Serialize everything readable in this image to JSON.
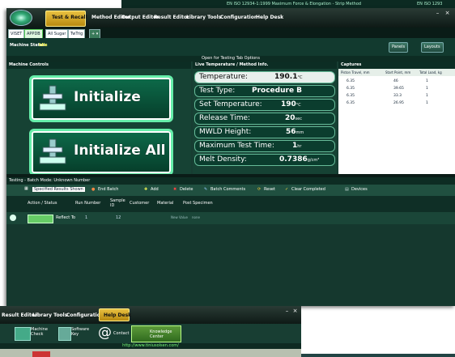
{
  "top_strip": {
    "text1": "EN ISO 12934-1:1999 Maximum Force & Elongation - Strip Method",
    "text2": "EN ISO 1293"
  },
  "menu": {
    "items": [
      "Test & Recall",
      "Method Editor",
      "Output Editor",
      "Result Editor",
      "Library Tools",
      "Configuration",
      "Help Desk"
    ]
  },
  "tabs": [
    "VISET",
    "APPDB",
    "All Sugar",
    "TwTrig"
  ],
  "status": {
    "label": "Machine Status:",
    "value": "Idle",
    "panels": "Panels",
    "layouts": "Layouts"
  },
  "open_testing": "Open for Testing Tab Options",
  "machine_controls": {
    "title": "Machine Controls",
    "initialize": "Initialize",
    "initialize_all": "Initialize All"
  },
  "live_temp": {
    "title": "Live Temperature / Method Info.",
    "rows": [
      {
        "label": "Temperature:",
        "value": "190.1",
        "unit": "°C"
      },
      {
        "label": "Test Type:",
        "value": "Procedure B",
        "unit": ""
      },
      {
        "label": "Set Temperature:",
        "value": "190",
        "unit": "°C"
      },
      {
        "label": "Release Time:",
        "value": "20",
        "unit": "sec"
      },
      {
        "label": "MWLD Height:",
        "value": "56",
        "unit": "mm"
      },
      {
        "label": "Maximum Test Time:",
        "value": "1",
        "unit": "hr"
      },
      {
        "label": "Melt Density:",
        "value": "0.7386",
        "unit": "g/cm³"
      }
    ]
  },
  "captures": {
    "title": "Captures",
    "headers": [
      "Piston Travel, mm",
      "Start Point, mm",
      "Total Load, kg"
    ],
    "rows": [
      [
        "6.35",
        "46",
        "1"
      ],
      [
        "6.35",
        "39.65",
        "1"
      ],
      [
        "6.35",
        "33.3",
        "1"
      ],
      [
        "6.35",
        "26.95",
        "1"
      ]
    ]
  },
  "testing_bar": "Testing - Batch Mode: Unknown Number",
  "toolbar": {
    "specified_results": "Specified Results Shown",
    "end_batch": "End Batch",
    "add": "Add",
    "delete": "Delete",
    "batch_comments": "Batch Comments",
    "reset": "Reset",
    "clear_completed": "Clear Completed",
    "devices": "Devices"
  },
  "table": {
    "headers": [
      "Action / Status",
      "Run Number",
      "Sample ID",
      "Customer",
      "Material",
      "Post Specimen"
    ],
    "row": {
      "status": "Reflect To",
      "run": "1",
      "sample": "12",
      "c1": "New Value",
      "c2": "none"
    }
  },
  "win2": {
    "menu": [
      "Result Editor",
      "Library Tools",
      "Configuration",
      "Help Desk"
    ],
    "ribbon": [
      "Machine Check",
      "Software Key",
      "Contact",
      "Knowledge Center"
    ],
    "url": "http://www.tiniusolsen.com/"
  },
  "colors": {
    "accent": "#e8c040",
    "panel": "#164234",
    "dark": "#0c2d24"
  }
}
